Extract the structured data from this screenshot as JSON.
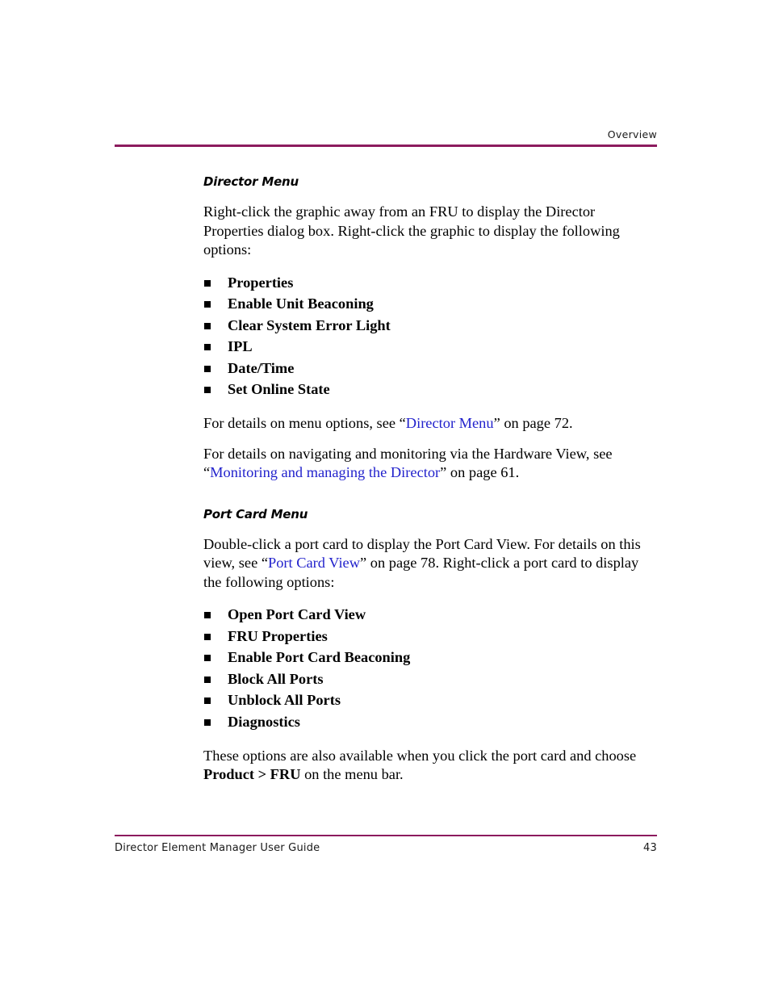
{
  "header": {
    "running_head": "Overview",
    "rule_color": "#8C1B5E"
  },
  "link_color": "#2222CC",
  "sections": [
    {
      "heading": "Director Menu",
      "intro_paragraph": "Right-click the graphic away from an FRU to display the Director Properties dialog box. Right-click the graphic to display the following options:",
      "bullets": [
        "Properties",
        "Enable Unit Beaconing",
        "Clear System Error Light",
        "IPL",
        "Date/Time",
        "Set Online State"
      ],
      "xref_para_1": {
        "before": "For details on menu options, see “",
        "link": "Director Menu",
        "after": "” on page 72."
      },
      "xref_para_2": {
        "before": "For details on navigating and monitoring via the Hardware View, see “",
        "link": "Monitoring and managing the Director",
        "after": "” on page 61."
      }
    },
    {
      "heading": "Port Card Menu",
      "intro_before": "Double-click a port card to display the Port Card View. For details on this view, see “",
      "intro_link": "Port Card View",
      "intro_after": "” on page 78. Right-click a port card to display the following options:",
      "bullets": [
        "Open Port Card View",
        "FRU Properties",
        "Enable Port Card Beaconing",
        "Block All Ports",
        "Unblock All Ports",
        "Diagnostics"
      ],
      "closing_before": "These options are also available when you click the port card and choose ",
      "closing_bold": "Product > FRU",
      "closing_after": " on the menu bar."
    }
  ],
  "footer": {
    "document_title": "Director Element Manager User Guide",
    "page_number": "43"
  }
}
